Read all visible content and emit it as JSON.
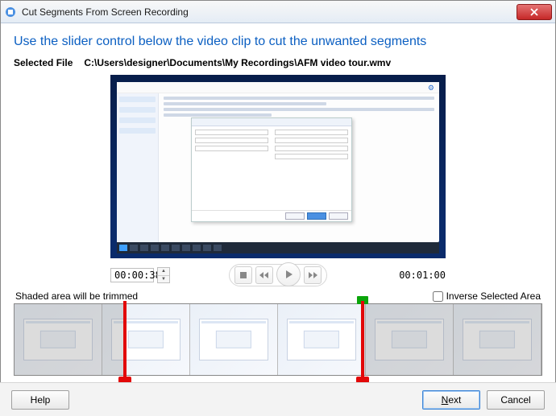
{
  "window": {
    "title": "Cut Segments From Screen Recording"
  },
  "heading": "Use the slider control below the video clip to cut the unwanted segments",
  "selected_file": {
    "label": "Selected File",
    "path": "C:\\Users\\designer\\Documents\\My Recordings\\AFM video tour.wmv"
  },
  "playback": {
    "current_time": "00:00:38",
    "total_time": "00:01:00"
  },
  "trim": {
    "label": "Shaded area will be trimmed",
    "inverse_label": "Inverse Selected Area",
    "inverse_checked": false,
    "markers": {
      "red_start_pct": 21,
      "green_end_pct": 66,
      "red_extra_pct": 66
    }
  },
  "buttons": {
    "help": "Help",
    "next": "Next",
    "next_key": "N",
    "cancel": "Cancel"
  },
  "icons": {
    "close": "close-icon",
    "stop": "stop-icon",
    "rewind": "rewind-icon",
    "play": "play-icon",
    "forward": "forward-icon"
  }
}
